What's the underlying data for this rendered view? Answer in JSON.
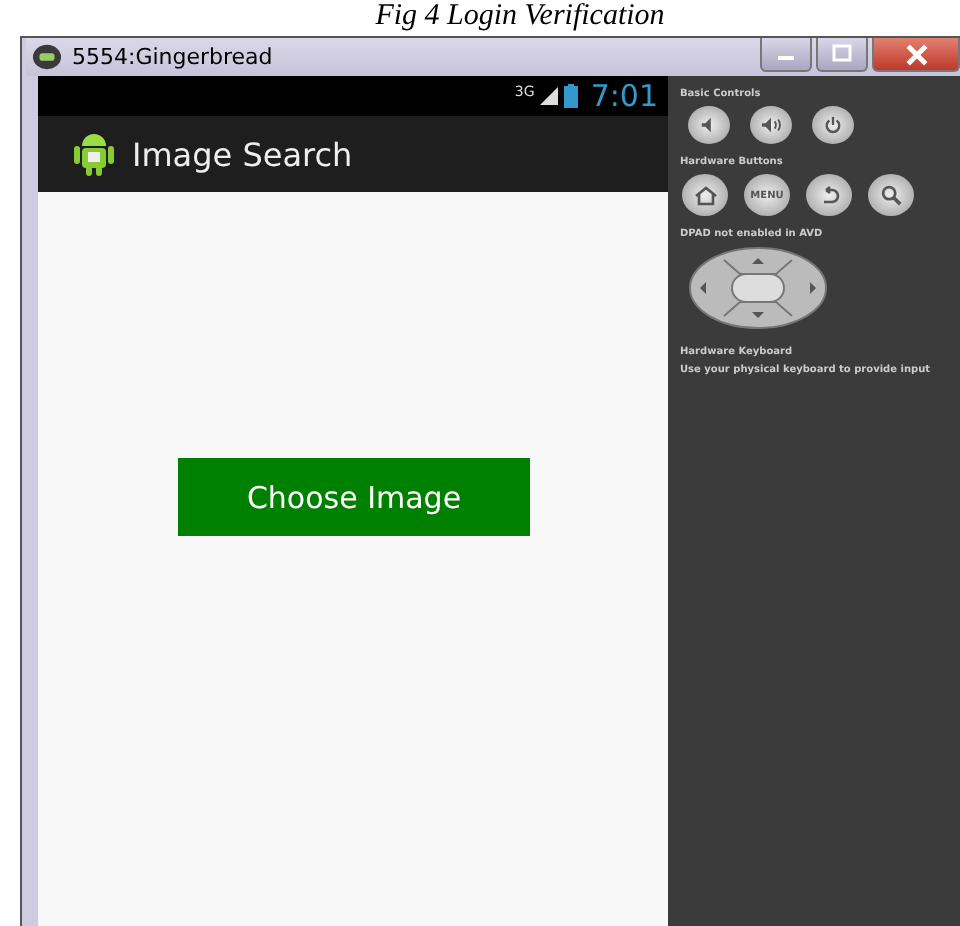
{
  "caption": "Fig 4 Login Verification",
  "window": {
    "title": "5554:Gingerbread"
  },
  "status_bar": {
    "network": "3G",
    "time": "7:01"
  },
  "action_bar": {
    "title": "Image Search"
  },
  "content": {
    "button": "Choose Image"
  },
  "controls_panel": {
    "basic_controls": "Basic Controls",
    "hardware_buttons": "Hardware Buttons",
    "menu_key": "MENU",
    "dpad": "DPAD not enabled in AVD",
    "keyboard_title": "Hardware Keyboard",
    "keyboard_hint": "Use your physical keyboard to provide input"
  }
}
